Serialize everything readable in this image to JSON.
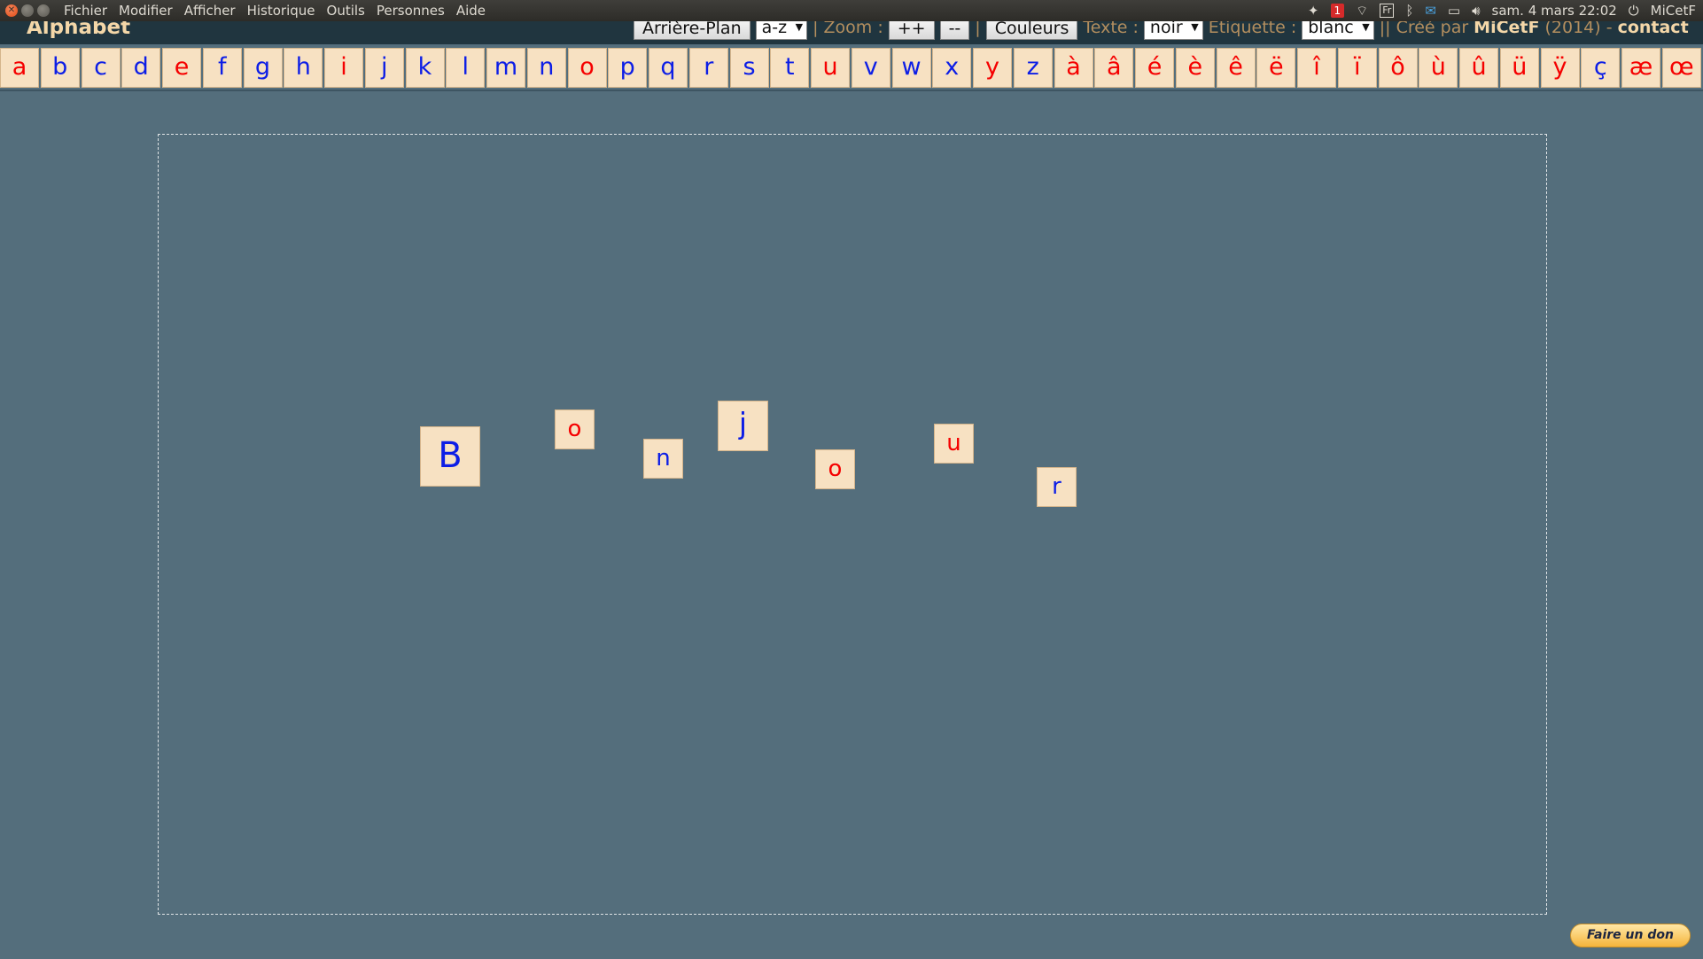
{
  "window_menu": [
    "Fichier",
    "Modifier",
    "Afficher",
    "Historique",
    "Outils",
    "Personnes",
    "Aide"
  ],
  "tray": {
    "notification_count": "1",
    "keyboard_layout": "Fr",
    "datetime": "sam. 4 mars 22:02",
    "user": "MiCetF",
    "icons": [
      "dropbox-icon",
      "wifi-icon",
      "bluetooth-icon",
      "mail-icon",
      "battery-icon",
      "volume-icon",
      "power-icon"
    ]
  },
  "app": {
    "title": "Alphabet",
    "toolbar": {
      "background_button": "Arrière-Plan",
      "order_select": "a-z",
      "sep1": "|",
      "zoom_label": "Zoom :",
      "zoom_in": "++",
      "zoom_out": "--",
      "sep2": "|",
      "colors_button": "Couleurs",
      "text_label": "Texte :",
      "text_select": "noir",
      "label_label": "Étiquette :",
      "label_select": "blanc",
      "credit_prefix": "|| Créé par",
      "credit_author": "MiCetF",
      "credit_year": "(2014) -",
      "contact_link": "contact"
    }
  },
  "letters": [
    {
      "ch": "a",
      "color": "red"
    },
    {
      "ch": "b",
      "color": "blue"
    },
    {
      "ch": "c",
      "color": "blue"
    },
    {
      "ch": "d",
      "color": "blue"
    },
    {
      "ch": "e",
      "color": "red"
    },
    {
      "ch": "f",
      "color": "blue"
    },
    {
      "ch": "g",
      "color": "blue"
    },
    {
      "ch": "h",
      "color": "blue"
    },
    {
      "ch": "i",
      "color": "red"
    },
    {
      "ch": "j",
      "color": "blue"
    },
    {
      "ch": "k",
      "color": "blue"
    },
    {
      "ch": "l",
      "color": "blue"
    },
    {
      "ch": "m",
      "color": "blue"
    },
    {
      "ch": "n",
      "color": "blue"
    },
    {
      "ch": "o",
      "color": "red"
    },
    {
      "ch": "p",
      "color": "blue"
    },
    {
      "ch": "q",
      "color": "blue"
    },
    {
      "ch": "r",
      "color": "blue"
    },
    {
      "ch": "s",
      "color": "blue"
    },
    {
      "ch": "t",
      "color": "blue"
    },
    {
      "ch": "u",
      "color": "red"
    },
    {
      "ch": "v",
      "color": "blue"
    },
    {
      "ch": "w",
      "color": "blue"
    },
    {
      "ch": "x",
      "color": "blue"
    },
    {
      "ch": "y",
      "color": "red"
    },
    {
      "ch": "z",
      "color": "blue"
    },
    {
      "ch": "à",
      "color": "red"
    },
    {
      "ch": "â",
      "color": "red"
    },
    {
      "ch": "é",
      "color": "red"
    },
    {
      "ch": "è",
      "color": "red"
    },
    {
      "ch": "ê",
      "color": "red"
    },
    {
      "ch": "ë",
      "color": "red"
    },
    {
      "ch": "î",
      "color": "red"
    },
    {
      "ch": "ï",
      "color": "red"
    },
    {
      "ch": "ô",
      "color": "red"
    },
    {
      "ch": "ù",
      "color": "red"
    },
    {
      "ch": "û",
      "color": "red"
    },
    {
      "ch": "ü",
      "color": "red"
    },
    {
      "ch": "ÿ",
      "color": "red"
    },
    {
      "ch": "ç",
      "color": "blue"
    },
    {
      "ch": "æ",
      "color": "red"
    },
    {
      "ch": "œ",
      "color": "red"
    }
  ],
  "tiles": [
    {
      "ch": "B",
      "color": "blue"
    },
    {
      "ch": "o",
      "color": "red"
    },
    {
      "ch": "n",
      "color": "blue"
    },
    {
      "ch": "j",
      "color": "blue"
    },
    {
      "ch": "o",
      "color": "red"
    },
    {
      "ch": "u",
      "color": "red"
    },
    {
      "ch": "r",
      "color": "blue"
    }
  ],
  "donate_button": "Faire un don",
  "colors": {
    "vowel": "#f50000",
    "consonant": "#0d1ee6",
    "tile_bg": "#f7e1c2",
    "page_bg": "#546e7c"
  }
}
